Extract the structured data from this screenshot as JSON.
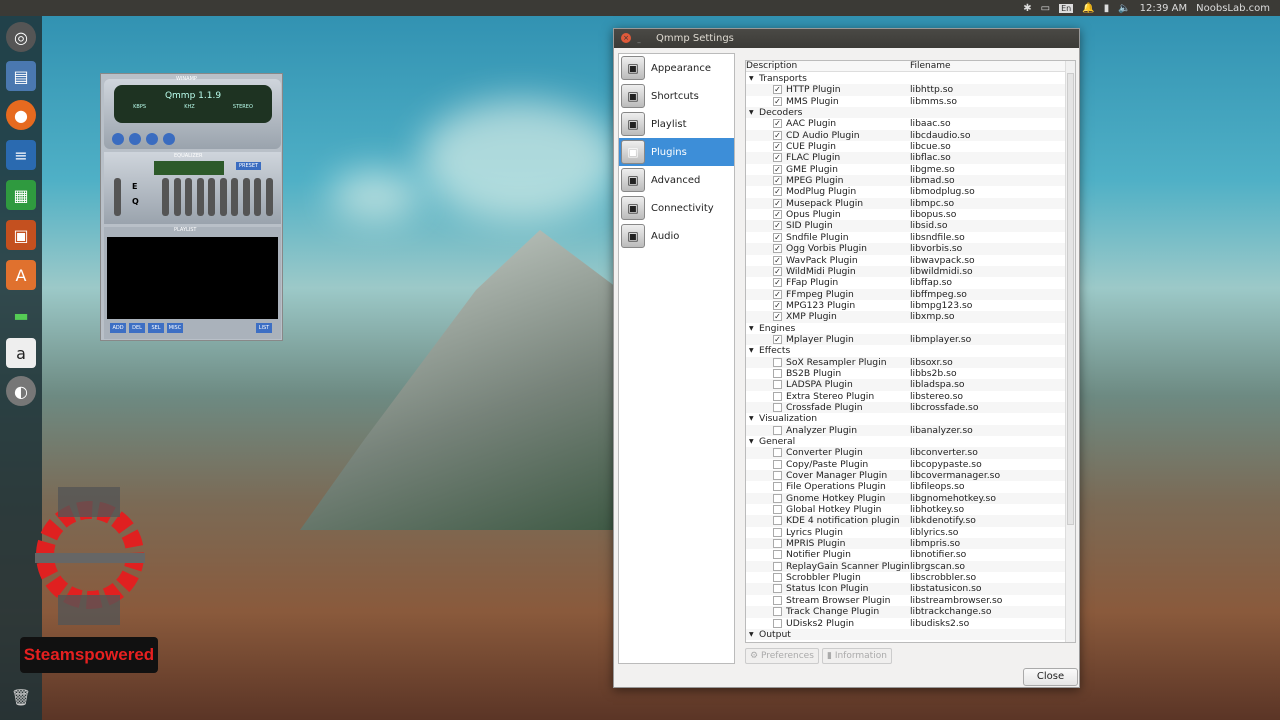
{
  "topbar": {
    "lang": "En",
    "time": "12:39 AM",
    "user": "NoobsLab.com"
  },
  "player": {
    "title": "Qmmp 1.1.9",
    "kbps": "KBPS",
    "khz": "KHZ",
    "stereo": "STEREO",
    "winamp": "WINAMP",
    "equalizer": "EQUALIZER",
    "preset": "PRESET",
    "playlist": "PLAYLIST",
    "eq_e": "E",
    "eq_q": "Q",
    "buttons": [
      "ADD",
      "DEL",
      "SEL",
      "MISC",
      "LIST"
    ]
  },
  "watermark": {
    "text": "Steamspowered"
  },
  "window": {
    "title": "Qmmp Settings",
    "close_label": "Close",
    "preferences_label": "Preferences",
    "information_label": "Information",
    "nav": [
      {
        "label": "Appearance",
        "icon": "appearance-icon"
      },
      {
        "label": "Shortcuts",
        "icon": "shortcuts-icon"
      },
      {
        "label": "Playlist",
        "icon": "playlist-icon"
      },
      {
        "label": "Plugins",
        "icon": "plugins-icon",
        "selected": true
      },
      {
        "label": "Advanced",
        "icon": "advanced-icon"
      },
      {
        "label": "Connectivity",
        "icon": "connectivity-icon"
      },
      {
        "label": "Audio",
        "icon": "audio-icon"
      }
    ],
    "columns": {
      "description": "Description",
      "filename": "Filename"
    },
    "groups": [
      {
        "name": "Transports",
        "items": [
          [
            "HTTP Plugin",
            "libhttp.so",
            true
          ],
          [
            "MMS Plugin",
            "libmms.so",
            true
          ]
        ]
      },
      {
        "name": "Decoders",
        "items": [
          [
            "AAC Plugin",
            "libaac.so",
            true
          ],
          [
            "CD Audio Plugin",
            "libcdaudio.so",
            true
          ],
          [
            "CUE Plugin",
            "libcue.so",
            true
          ],
          [
            "FLAC Plugin",
            "libflac.so",
            true
          ],
          [
            "GME Plugin",
            "libgme.so",
            true
          ],
          [
            "MPEG Plugin",
            "libmad.so",
            true
          ],
          [
            "ModPlug Plugin",
            "libmodplug.so",
            true
          ],
          [
            "Musepack Plugin",
            "libmpc.so",
            true
          ],
          [
            "Opus Plugin",
            "libopus.so",
            true
          ],
          [
            "SID Plugin",
            "libsid.so",
            true
          ],
          [
            "Sndfile Plugin",
            "libsndfile.so",
            true
          ],
          [
            "Ogg Vorbis Plugin",
            "libvorbis.so",
            true
          ],
          [
            "WavPack Plugin",
            "libwavpack.so",
            true
          ],
          [
            "WildMidi Plugin",
            "libwildmidi.so",
            true
          ],
          [
            "FFap Plugin",
            "libffap.so",
            true
          ],
          [
            "FFmpeg Plugin",
            "libffmpeg.so",
            true
          ],
          [
            "MPG123 Plugin",
            "libmpg123.so",
            true
          ],
          [
            "XMP Plugin",
            "libxmp.so",
            true
          ]
        ]
      },
      {
        "name": "Engines",
        "items": [
          [
            "Mplayer Plugin",
            "libmplayer.so",
            true
          ]
        ]
      },
      {
        "name": "Effects",
        "items": [
          [
            "SoX Resampler Plugin",
            "libsoxr.so",
            false
          ],
          [
            "BS2B Plugin",
            "libbs2b.so",
            false
          ],
          [
            "LADSPA Plugin",
            "libladspa.so",
            false
          ],
          [
            "Extra Stereo Plugin",
            "libstereo.so",
            false
          ],
          [
            "Crossfade Plugin",
            "libcrossfade.so",
            false
          ]
        ]
      },
      {
        "name": "Visualization",
        "items": [
          [
            "Analyzer Plugin",
            "libanalyzer.so",
            false
          ]
        ]
      },
      {
        "name": "General",
        "items": [
          [
            "Converter Plugin",
            "libconverter.so",
            false
          ],
          [
            "Copy/Paste Plugin",
            "libcopypaste.so",
            false
          ],
          [
            "Cover Manager Plugin",
            "libcovermanager.so",
            false
          ],
          [
            "File Operations Plugin",
            "libfileops.so",
            false
          ],
          [
            "Gnome Hotkey Plugin",
            "libgnomehotkey.so",
            false
          ],
          [
            "Global Hotkey Plugin",
            "libhotkey.so",
            false
          ],
          [
            "KDE 4 notification plugin",
            "libkdenotify.so",
            false
          ],
          [
            "Lyrics Plugin",
            "liblyrics.so",
            false
          ],
          [
            "MPRIS Plugin",
            "libmpris.so",
            false
          ],
          [
            "Notifier Plugin",
            "libnotifier.so",
            false
          ],
          [
            "ReplayGain Scanner Plugin",
            "librgscan.so",
            false
          ],
          [
            "Scrobbler Plugin",
            "libscrobbler.so",
            false
          ],
          [
            "Status Icon Plugin",
            "libstatusicon.so",
            false
          ],
          [
            "Stream Browser Plugin",
            "libstreambrowser.so",
            false
          ],
          [
            "Track Change Plugin",
            "libtrackchange.so",
            false
          ],
          [
            "UDisks2 Plugin",
            "libudisks2.so",
            false
          ]
        ]
      },
      {
        "name": "Output",
        "items": []
      }
    ]
  }
}
